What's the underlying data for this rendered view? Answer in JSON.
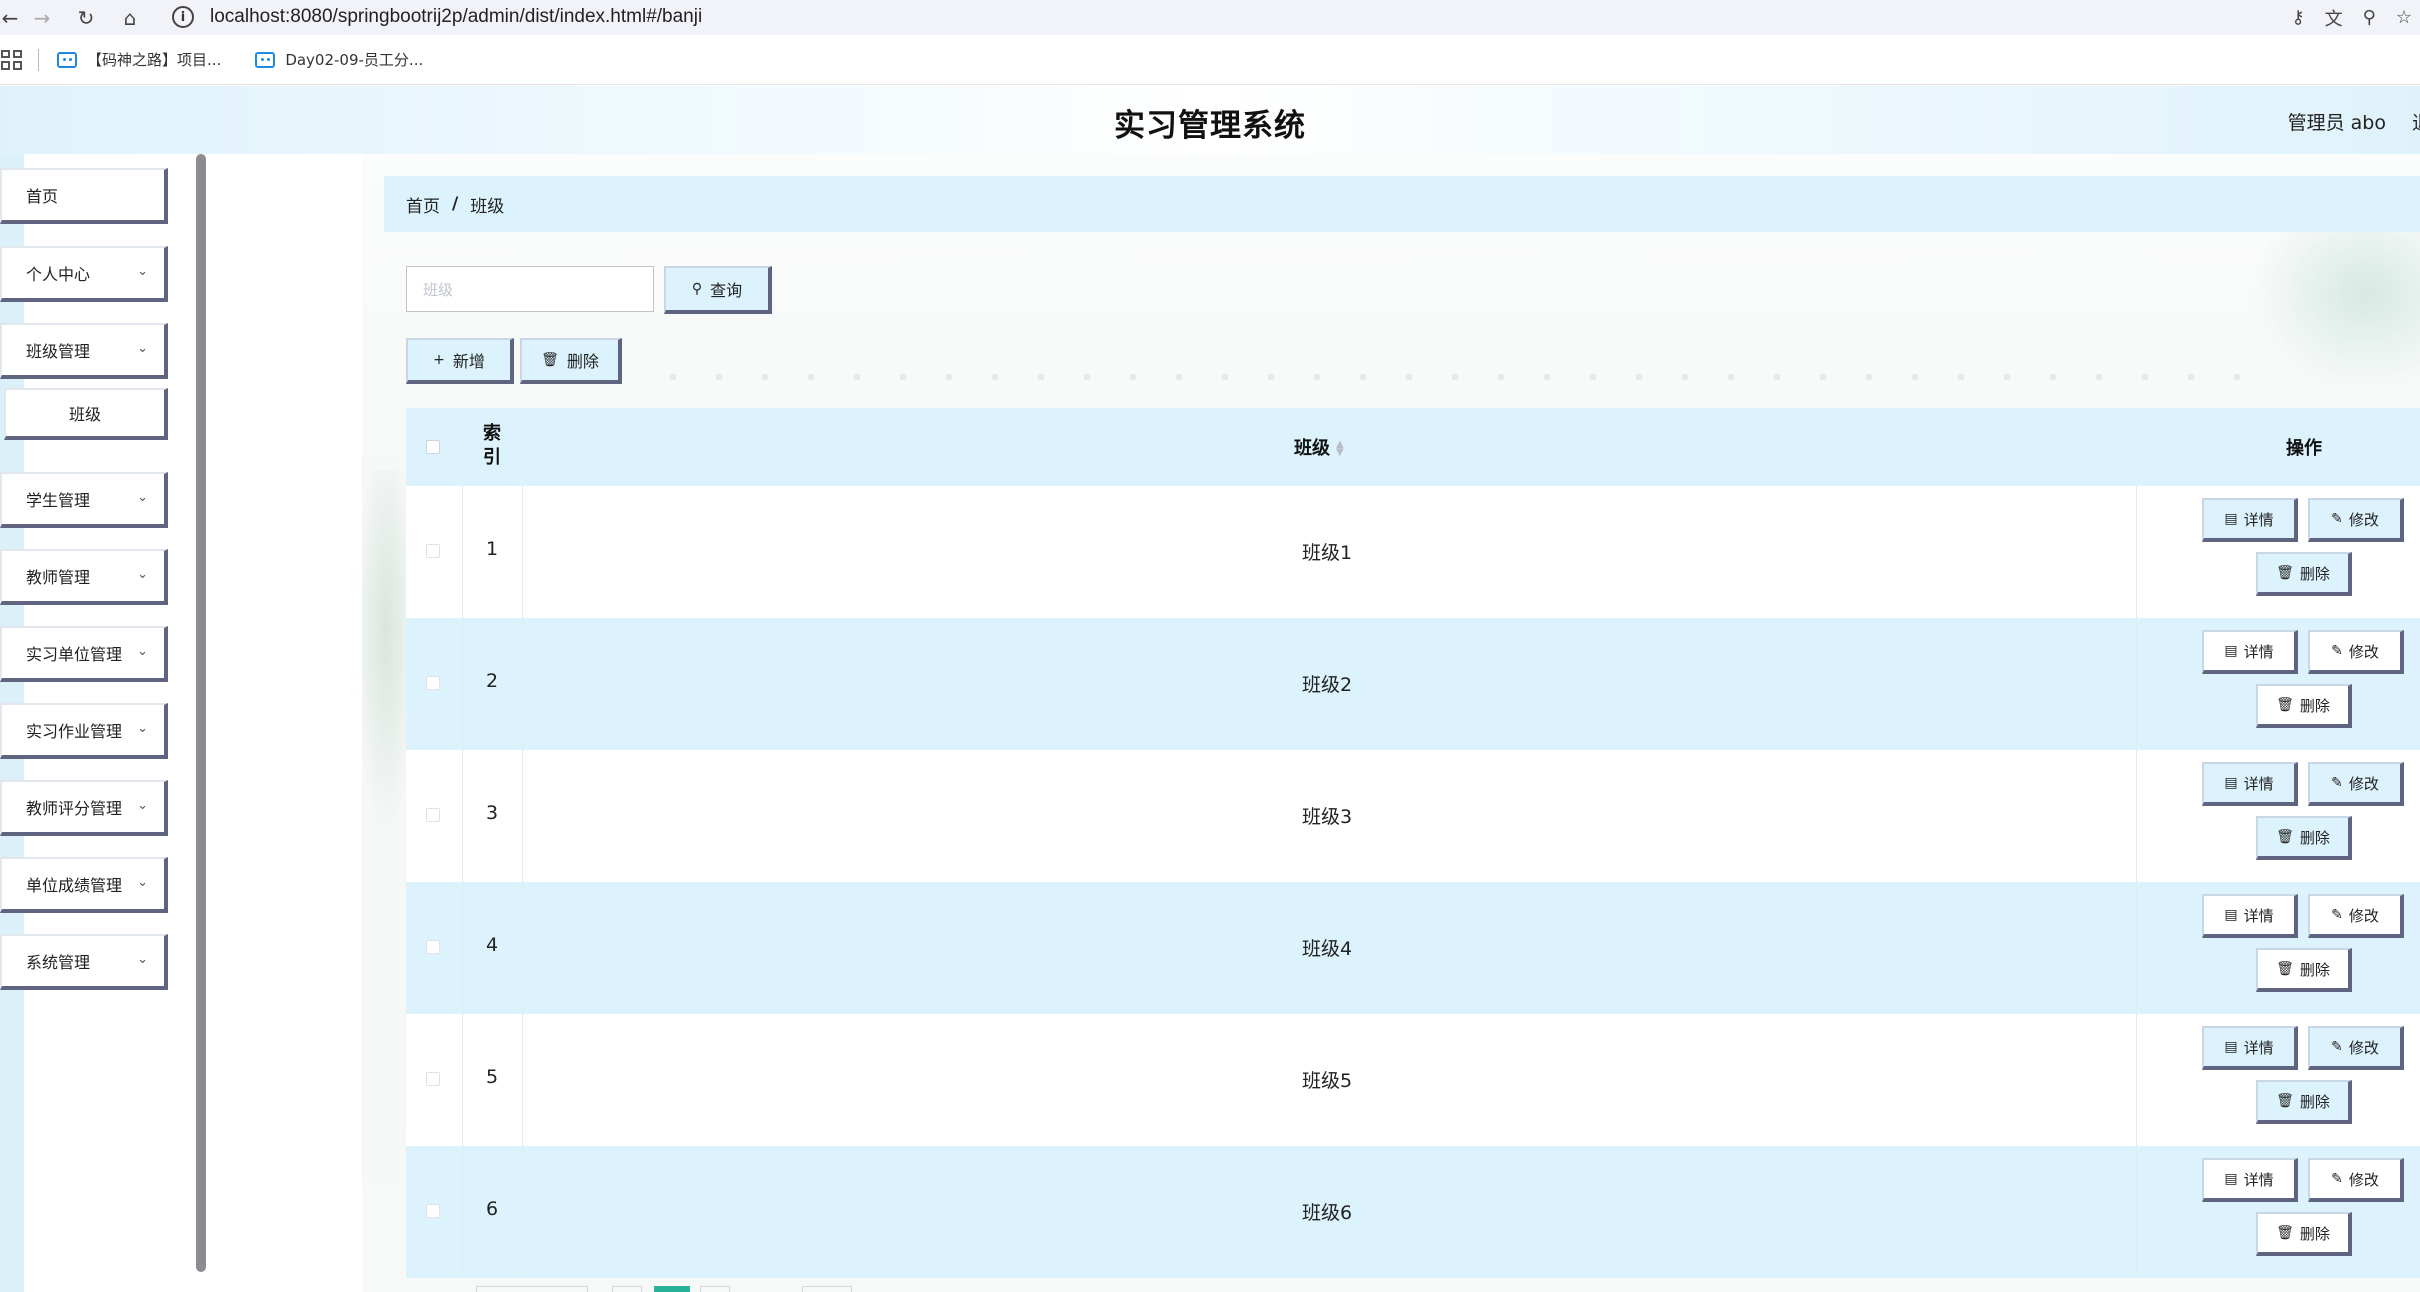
{
  "browser": {
    "url": "localhost:8080/springbootrij2p/admin/dist/index.html#/banji",
    "info_icon": "i",
    "back_icon": "arrow-left",
    "forward_icon": "arrow-right",
    "reload_icon": "reload",
    "home_icon": "home",
    "right_icons": [
      "key-icon",
      "translate-icon",
      "zoom-icon",
      "star-icon"
    ],
    "bookmarks": [
      {
        "label": "【码神之路】项目..."
      },
      {
        "label": "Day02-09-员工分..."
      }
    ]
  },
  "header": {
    "title": "实习管理系统",
    "user": "管理员 abo",
    "user_overflow": "退"
  },
  "sidebar": {
    "items": [
      {
        "label": "首页",
        "has_chevron": false
      },
      {
        "label": "个人中心",
        "has_chevron": true
      },
      {
        "label": "班级管理",
        "has_chevron": true
      },
      {
        "label": "学生管理",
        "has_chevron": true
      },
      {
        "label": "教师管理",
        "has_chevron": true
      },
      {
        "label": "实习单位管理",
        "has_chevron": true
      },
      {
        "label": "实习作业管理",
        "has_chevron": true
      },
      {
        "label": "教师评分管理",
        "has_chevron": true
      },
      {
        "label": "单位成绩管理",
        "has_chevron": true
      },
      {
        "label": "系统管理",
        "has_chevron": true
      }
    ],
    "sub_item": {
      "label": "班级"
    }
  },
  "breadcrumb": {
    "home": "首页",
    "separator": "/",
    "current": "班级"
  },
  "search": {
    "placeholder": "班级",
    "button_label": "查询"
  },
  "toolbar": {
    "add_label": "新增",
    "delete_label": "删除"
  },
  "table": {
    "columns": {
      "index": "索引",
      "class": "班级",
      "actions": "操作"
    },
    "rows": [
      {
        "index": "1",
        "class": "班级1"
      },
      {
        "index": "2",
        "class": "班级2"
      },
      {
        "index": "3",
        "class": "班级3"
      },
      {
        "index": "4",
        "class": "班级4"
      },
      {
        "index": "5",
        "class": "班级5"
      },
      {
        "index": "6",
        "class": "班级6"
      }
    ],
    "row_actions": {
      "detail": "详情",
      "edit": "修改",
      "delete": "删除"
    }
  },
  "colors": {
    "accent_light_blue": "#dcf2fc",
    "button_shadow": "#5f6580",
    "pager_active": "#27b39a"
  }
}
